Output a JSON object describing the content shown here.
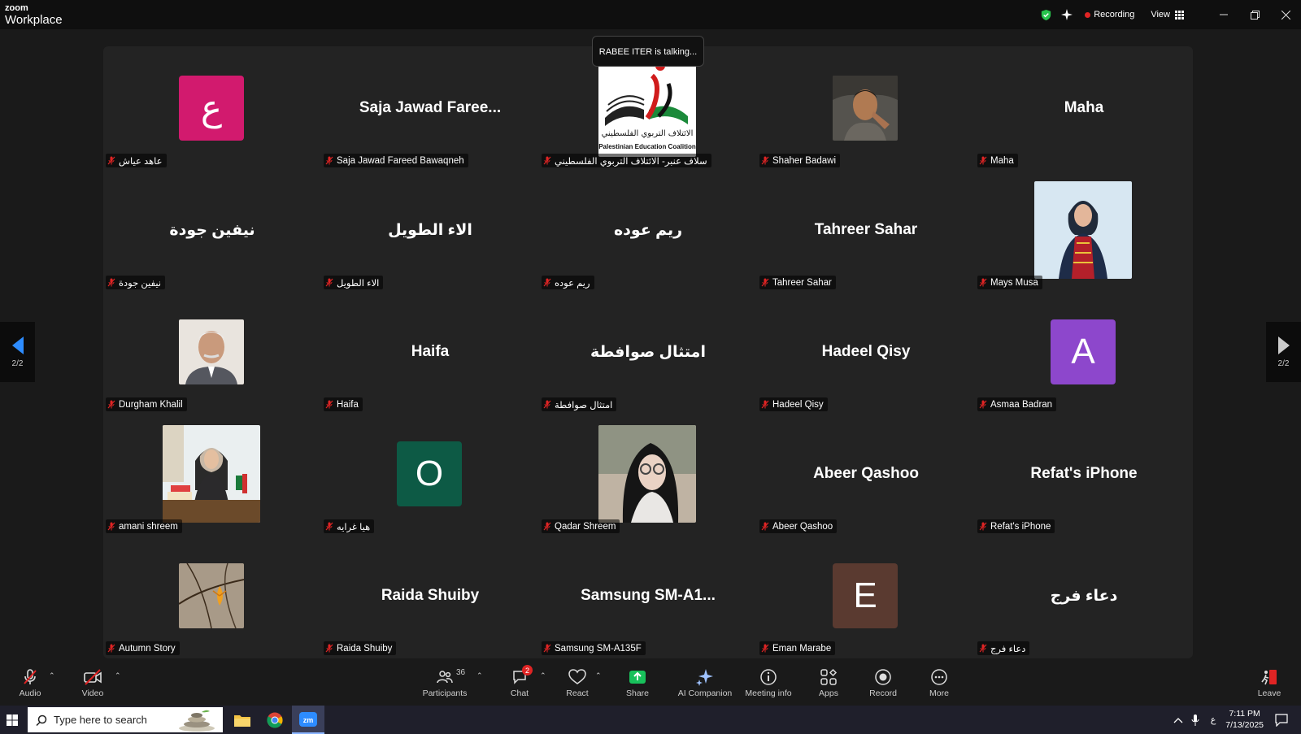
{
  "app": {
    "logo_top": "zoom",
    "logo_bottom": "Workplace",
    "recording_label": "Recording",
    "view_label": "View"
  },
  "speaking": "RABEE ITER is talking...",
  "colors": {
    "pink": "#d21a6e",
    "green": "#0d5a45",
    "purple": "#8d47cc",
    "brown": "#5a3a30",
    "recording": "#e02424",
    "shield": "#27c24c",
    "share": "#18c15b"
  },
  "participants": [
    {
      "label": "عاهد عياش",
      "tile": "ع",
      "color": "#d21a6e"
    },
    {
      "label": "Saja Jawad Fareed Bawaqneh",
      "big": "Saja Jawad Faree..."
    },
    {
      "label": "سلاف عنبر- الائتلاف التربوي الفلسطيني",
      "photo": "logo"
    },
    {
      "label": "Shaher Badawi",
      "photo": "man1"
    },
    {
      "label": "Maha",
      "big": "Maha"
    },
    {
      "label": "نيفين جودة",
      "big": "نيفين جودة"
    },
    {
      "label": "الاء الطويل",
      "big": "الاء الطويل"
    },
    {
      "label": "ريم عوده",
      "big": "ريم عوده"
    },
    {
      "label": "Tahreer Sahar",
      "big": "Tahreer Sahar"
    },
    {
      "label": "Mays Musa",
      "photo": "woman1"
    },
    {
      "label": "Durgham Khalil",
      "photo": "man2"
    },
    {
      "label": "Haifa",
      "big": "Haifa"
    },
    {
      "label": "امتثال صوافطة",
      "big": "امتثال صوافطة"
    },
    {
      "label": "Hadeel Qisy",
      "big": "Hadeel Qisy"
    },
    {
      "label": "Asmaa Badran",
      "tile": "A",
      "color": "#8d47cc"
    },
    {
      "label": "amani shreem",
      "photo": "office"
    },
    {
      "label": "هيا غرايه",
      "tile": "O",
      "color": "#0d5a45"
    },
    {
      "label": "Qadar Shreem",
      "photo": "woman2"
    },
    {
      "label": "Abeer Qashoo",
      "big": "Abeer Qashoo"
    },
    {
      "label": "Refat's iPhone",
      "big": "Refat's iPhone"
    },
    {
      "label": "Autumn Story",
      "photo": "leaf"
    },
    {
      "label": "Raida Shuiby",
      "big": "Raida Shuiby"
    },
    {
      "label": "Samsung SM-A135F",
      "big": "Samsung  SM-A1..."
    },
    {
      "label": "Eman Marabe",
      "tile": "E",
      "color": "#5a3a30"
    },
    {
      "label": "دعاء فرج",
      "big": "دعاء فرج"
    }
  ],
  "logo_text": {
    "ar": "الائتلاف التربوي الفلسطيني",
    "en": "Palestinian Education Coalition"
  },
  "nav": {
    "page_left": "2/2",
    "page_right": "2/2"
  },
  "toolbar": {
    "audio": "Audio",
    "video": "Video",
    "participants": "Participants",
    "participant_count": "36",
    "chat": "Chat",
    "chat_badge": "2",
    "react": "React",
    "share": "Share",
    "ai": "AI Companion",
    "info": "Meeting info",
    "apps": "Apps",
    "record": "Record",
    "more": "More",
    "leave": "Leave"
  },
  "taskbar": {
    "search_placeholder": "Type here to search",
    "ime": "ع",
    "time": "7:11 PM",
    "date": "7/13/2025"
  }
}
